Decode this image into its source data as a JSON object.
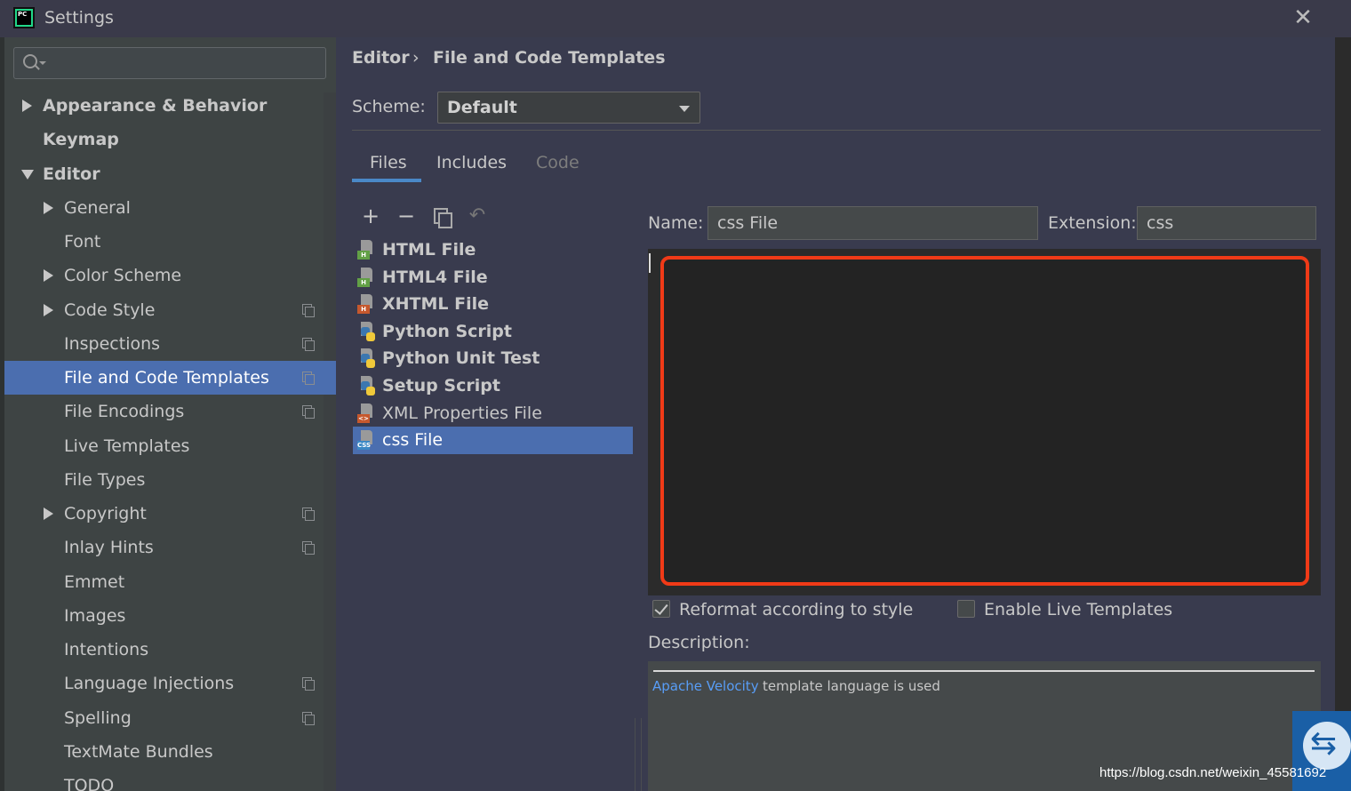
{
  "window": {
    "title": "Settings",
    "app_icon_text": "PC",
    "close_glyph": "✕"
  },
  "sidebar": {
    "search_placeholder": "",
    "items": [
      {
        "label": "Appearance & Behavior",
        "expander": "collapsed",
        "bold": true,
        "level": 0
      },
      {
        "label": "Keymap",
        "expander": "none",
        "bold": true,
        "level": 0
      },
      {
        "label": "Editor",
        "expander": "expanded",
        "bold": true,
        "level": 0
      },
      {
        "label": "General",
        "expander": "collapsed",
        "level": 1
      },
      {
        "label": "Font",
        "expander": "none",
        "level": 1
      },
      {
        "label": "Color Scheme",
        "expander": "collapsed",
        "level": 1
      },
      {
        "label": "Code Style",
        "expander": "collapsed",
        "level": 1,
        "project_icon": true
      },
      {
        "label": "Inspections",
        "expander": "none",
        "level": 1,
        "project_icon": true
      },
      {
        "label": "File and Code Templates",
        "expander": "none",
        "level": 1,
        "project_icon": true,
        "selected": true
      },
      {
        "label": "File Encodings",
        "expander": "none",
        "level": 1,
        "project_icon": true
      },
      {
        "label": "Live Templates",
        "expander": "none",
        "level": 1
      },
      {
        "label": "File Types",
        "expander": "none",
        "level": 1
      },
      {
        "label": "Copyright",
        "expander": "collapsed",
        "level": 1,
        "project_icon": true
      },
      {
        "label": "Inlay Hints",
        "expander": "none",
        "level": 1,
        "project_icon": true
      },
      {
        "label": "Emmet",
        "expander": "none",
        "level": 1
      },
      {
        "label": "Images",
        "expander": "none",
        "level": 1
      },
      {
        "label": "Intentions",
        "expander": "none",
        "level": 1
      },
      {
        "label": "Language Injections",
        "expander": "none",
        "level": 1,
        "project_icon": true
      },
      {
        "label": "Spelling",
        "expander": "none",
        "level": 1,
        "project_icon": true
      },
      {
        "label": "TextMate Bundles",
        "expander": "none",
        "level": 1
      },
      {
        "label": "TODO",
        "expander": "none",
        "level": 1
      }
    ]
  },
  "breadcrumb": {
    "parent": "Editor",
    "separator": "›",
    "current": "File and Code Templates"
  },
  "scheme": {
    "label": "Scheme:",
    "value": "Default"
  },
  "tabs": [
    {
      "label": "Files",
      "active": true
    },
    {
      "label": "Includes"
    },
    {
      "label": "Code",
      "disabled": true
    }
  ],
  "toolbar": {
    "add": "+",
    "remove": "−",
    "revert": "↶"
  },
  "templates": [
    {
      "label": "HTML File",
      "bold": true,
      "icon": "html-file-icon",
      "badge": "H",
      "badge_color": "green"
    },
    {
      "label": "HTML4 File",
      "bold": true,
      "icon": "html-file-icon",
      "badge": "H",
      "badge_color": "green"
    },
    {
      "label": "XHTML File",
      "bold": true,
      "icon": "xhtml-file-icon",
      "badge": "H",
      "badge_color": "orange"
    },
    {
      "label": "Python Script",
      "bold": true,
      "icon": "python-file-icon"
    },
    {
      "label": "Python Unit Test",
      "bold": true,
      "icon": "python-file-icon"
    },
    {
      "label": "Setup Script",
      "bold": true,
      "icon": "python-file-icon"
    },
    {
      "label": "XML Properties File",
      "bold": false,
      "icon": "xml-file-icon",
      "badge": "<>",
      "badge_color": "orange"
    },
    {
      "label": "css File",
      "bold": false,
      "icon": "css-file-icon",
      "badge": "CSS",
      "badge_color": "blue",
      "selected": true
    }
  ],
  "form": {
    "name_label": "Name:",
    "name_value": "css File",
    "extension_label": "Extension:",
    "extension_value": "css"
  },
  "options": {
    "reformat_label": "Reformat according to style",
    "reformat_checked": true,
    "live_templates_label": "Enable Live Templates",
    "live_templates_checked": false
  },
  "description": {
    "label": "Description:",
    "link_text": "Apache Velocity",
    "text": "template language is used"
  },
  "watermark": "https://blog.csdn.net/weixin_45581692",
  "colors": {
    "selection": "#4b6eaf",
    "highlight_border": "#f03a17",
    "link": "#589df6"
  }
}
